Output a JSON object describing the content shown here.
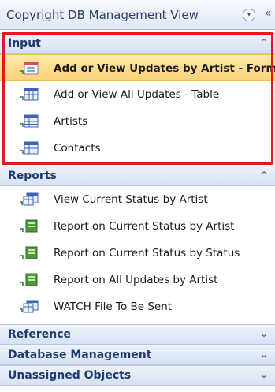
{
  "pane": {
    "title": "Copyright DB Management View",
    "dropdown_glyph": "▾",
    "shutter_glyph": "«"
  },
  "groups": {
    "input": {
      "label": "Input",
      "chevron": "⌃",
      "items": [
        {
          "label": "Add or View Updates by Artist - Form",
          "icon": "form-icon"
        },
        {
          "label": "Add or View All Updates - Table",
          "icon": "table-icon"
        },
        {
          "label": "Artists",
          "icon": "table-icon"
        },
        {
          "label": "Contacts",
          "icon": "table-icon"
        }
      ]
    },
    "reports": {
      "label": "Reports",
      "chevron": "⌃",
      "items": [
        {
          "label": "View Current Status by Artist",
          "icon": "query-icon"
        },
        {
          "label": "Report on Current Status by Artist",
          "icon": "report-icon"
        },
        {
          "label": "Report on Current Status by Status",
          "icon": "report-icon"
        },
        {
          "label": "Report on All Updates by Artist",
          "icon": "report-icon"
        },
        {
          "label": "WATCH File To Be Sent",
          "icon": "query-icon"
        }
      ]
    },
    "reference": {
      "label": "Reference",
      "chevron": "⌄"
    },
    "database_management": {
      "label": "Database Management",
      "chevron": "⌄"
    },
    "unassigned_objects": {
      "label": "Unassigned Objects",
      "chevron": "⌄"
    }
  },
  "colors": {
    "highlight_box": "#e01b1b",
    "selected_item": "#fbd27a",
    "group_header_text": "#1f3a6e"
  }
}
